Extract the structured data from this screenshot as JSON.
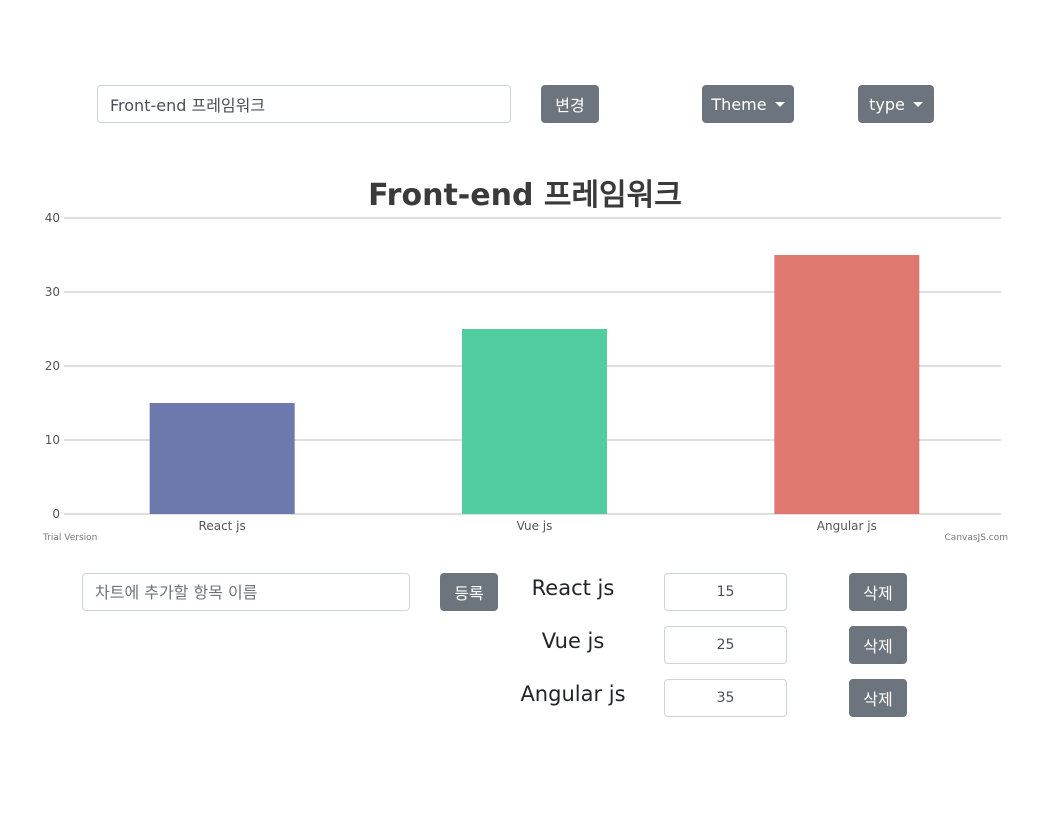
{
  "toolbar": {
    "title_input_value": "Front-end 프레임워크",
    "change_label": "변경",
    "theme_label": "Theme",
    "type_label": "type"
  },
  "chart_data": {
    "type": "bar",
    "title": "Front-end 프레임워크",
    "categories": [
      "React js",
      "Vue js",
      "Angular js"
    ],
    "values": [
      15,
      25,
      35
    ],
    "colors": [
      "#6d78ad",
      "#51cda0",
      "#df7970"
    ],
    "ylim": [
      0,
      40
    ],
    "yticks": [
      0,
      10,
      20,
      30,
      40
    ],
    "grid": true,
    "watermark_left": "Trial Version",
    "watermark_right": "CanvasJS.com"
  },
  "editor": {
    "new_item_placeholder": "차트에 추가할 항목 이름",
    "register_label": "등록",
    "delete_label": "삭제",
    "rows": [
      {
        "label": "React js",
        "value": "15"
      },
      {
        "label": "Vue js",
        "value": "25"
      },
      {
        "label": "Angular js",
        "value": "35"
      }
    ]
  }
}
